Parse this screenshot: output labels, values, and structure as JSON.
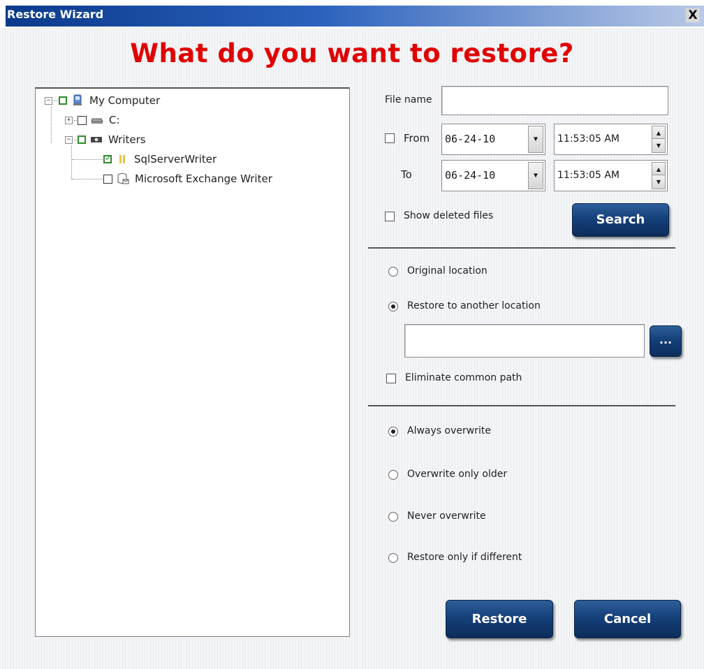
{
  "window": {
    "title": "Restore Wizard",
    "close_label": "X"
  },
  "heading": "What do you want to restore?",
  "tree": {
    "items": [
      {
        "label": "My Computer",
        "checked": false
      },
      {
        "label": "C:",
        "checked": false
      },
      {
        "label": "Writers",
        "checked": false
      },
      {
        "label": "SqlServerWriter",
        "checked": true
      },
      {
        "label": "Microsoft Exchange Writer",
        "checked": false
      }
    ]
  },
  "search": {
    "file_name_label": "File name",
    "file_name_value": "",
    "from_label": "From",
    "to_label": "To",
    "from_date": "06-24-10",
    "from_time": "11:53:05 AM",
    "to_date": "06-24-10",
    "to_time": "11:53:05 AM",
    "show_deleted_label": "Show deleted files",
    "search_button": "Search"
  },
  "location": {
    "original_label": "Original location",
    "another_label": "Restore to another location",
    "path_value": "",
    "browse_label": "...",
    "eliminate_label": "Eliminate common path"
  },
  "overwrite": {
    "always_label": "Always overwrite",
    "older_label": "Overwrite only older",
    "never_label": "Never overwrite",
    "different_label": "Restore only if different",
    "selected": "Always overwrite"
  },
  "actions": {
    "restore_button": "Restore",
    "cancel_button": "Cancel"
  }
}
